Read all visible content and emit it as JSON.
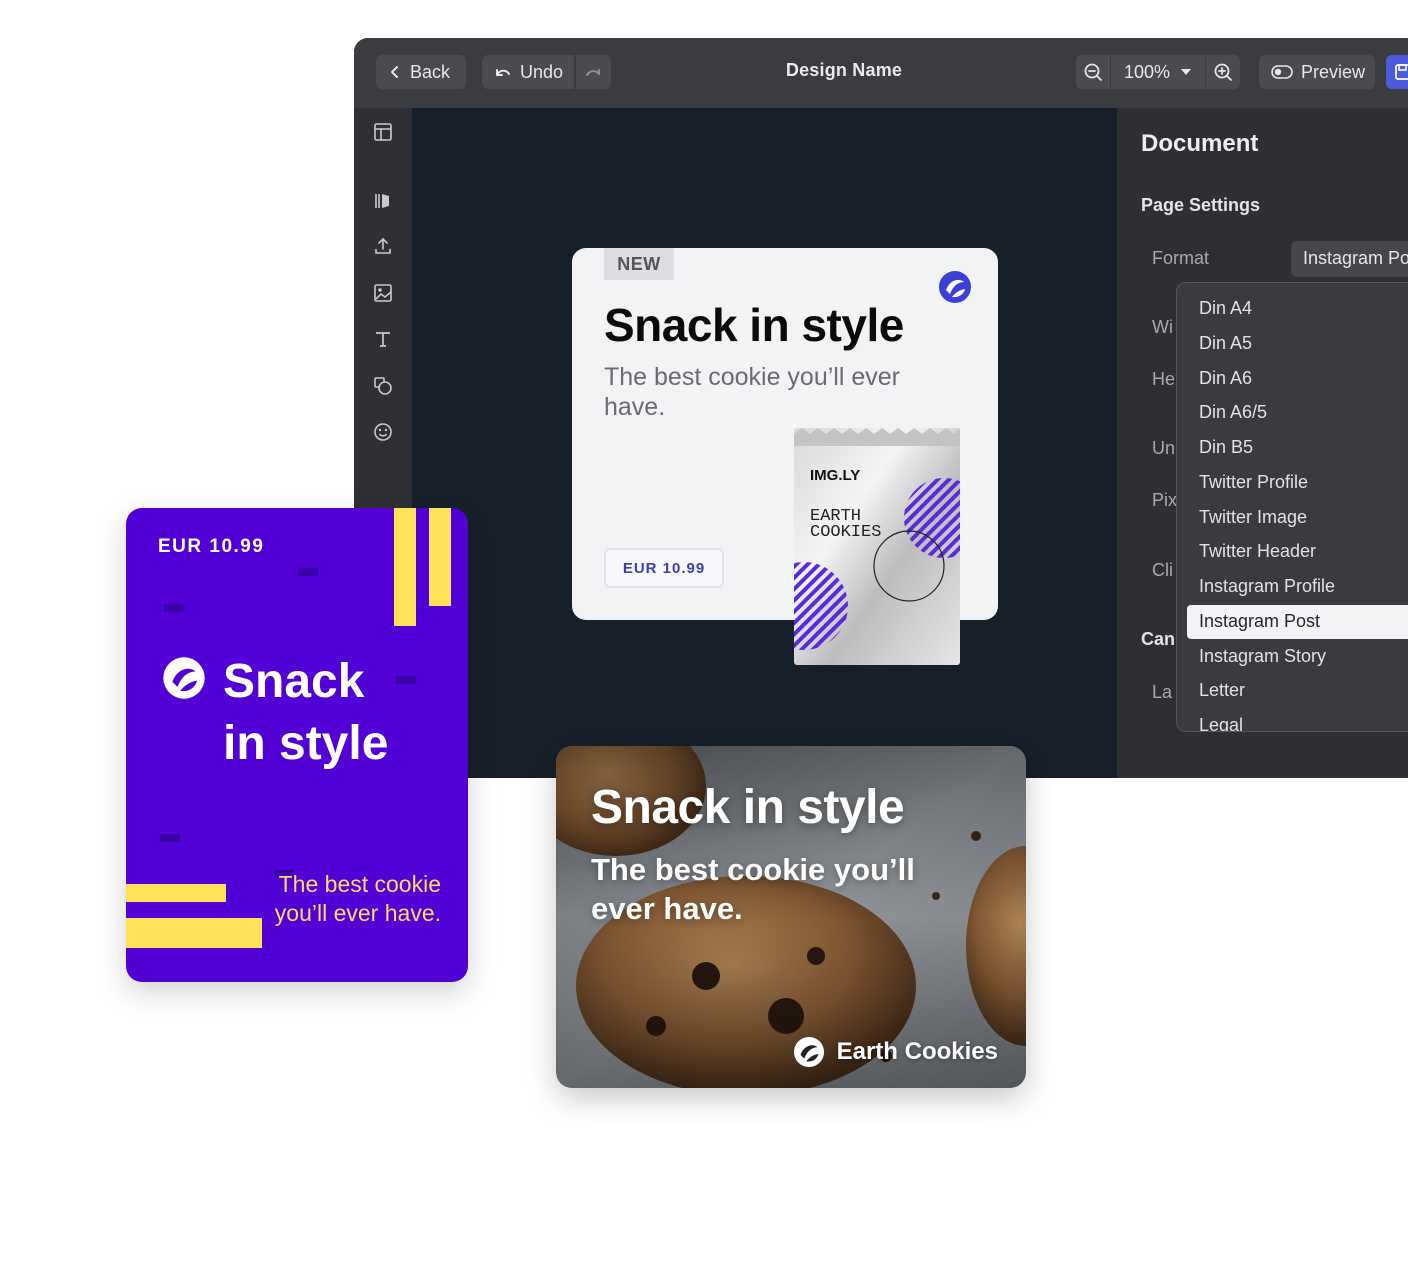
{
  "toolbar": {
    "back_label": "Back",
    "undo_label": "Undo",
    "design_name": "Design Name",
    "zoom_level": "100%",
    "preview_label": "Preview"
  },
  "panel": {
    "title": "Document",
    "section_page_settings": "Page Settings",
    "format_label": "Format",
    "format_value": "Instagram Po",
    "partial_labels": [
      "Wi",
      "He",
      "Un",
      "Pix",
      "Cli",
      "La"
    ],
    "section_canvas_partial": "Can",
    "format_options": [
      "Din A4",
      "Din A5",
      "Din A6",
      "Din A6/5",
      "Din B5",
      "Twitter Profile",
      "Twitter Image",
      "Twitter Header",
      "Instagram Profile",
      "Instagram Post",
      "Instagram Story",
      "Letter",
      "Legal"
    ],
    "selected_option": "Instagram Post"
  },
  "light_card": {
    "badge": "NEW",
    "title": "Snack in style",
    "subtitle": "The best cookie you’ll ever have.",
    "price": "EUR 10.99",
    "pouch_brand": "IMG.LY",
    "pouch_product_line1": "EARTH",
    "pouch_product_line2": "COOKIES"
  },
  "purple_card": {
    "price": "EUR 10.99",
    "title_line1": "Snack",
    "title_line2": "in style",
    "subtitle": "The best cookie you’ll ever have."
  },
  "photo_card": {
    "title": "Snack in style",
    "subtitle": "The best cookie you’ll ever have.",
    "brand": "Earth Cookies"
  },
  "colors": {
    "accent_blue": "#4a5bdc",
    "brand_purple": "#5200d6",
    "brand_yellow": "#ffe15a"
  },
  "icons": {
    "leftbar": [
      "layout-icon",
      "library-icon",
      "upload-icon",
      "image-icon",
      "text-icon",
      "shapes-icon",
      "sticker-icon"
    ]
  }
}
